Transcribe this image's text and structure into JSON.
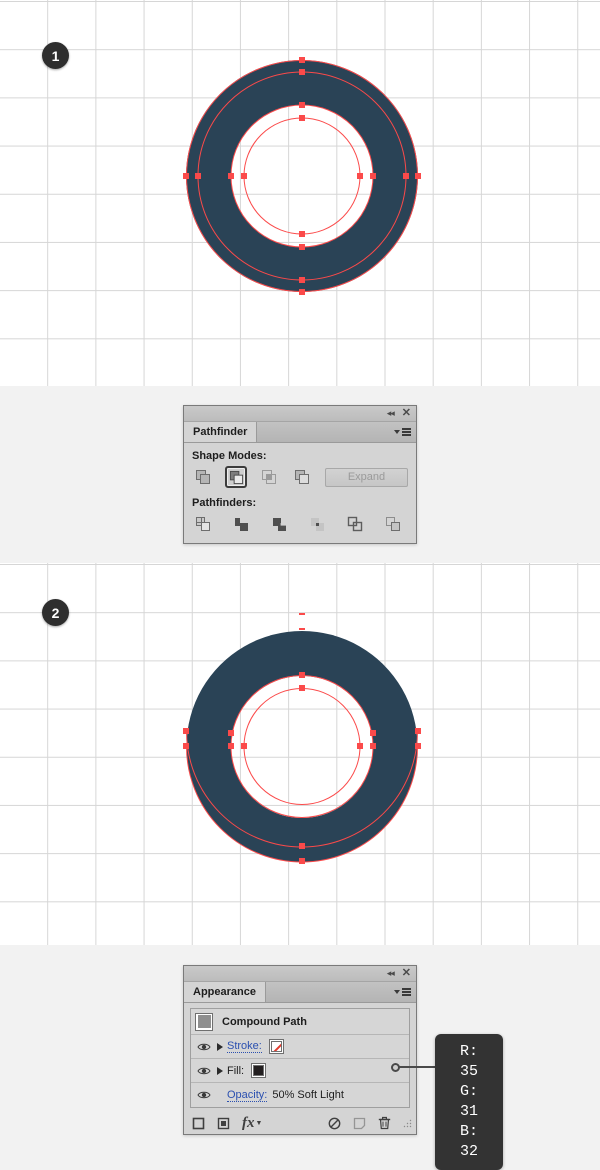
{
  "steps": [
    {
      "number": "1"
    },
    {
      "number": "2"
    }
  ],
  "artwork": {
    "fill_color": "#2a4356",
    "shade_color": "#1d3241",
    "path_color": "#fb4a4a",
    "anchor_color": "#fb4a4a",
    "step1_name": "donut-ring-flat",
    "step2_name": "donut-ring-extruded"
  },
  "pathfinder_panel": {
    "tab_label": "Pathfinder",
    "collapse_icon": "collapse-icon",
    "close_icon": "close-icon",
    "menu_icon": "panel-menu-icon",
    "shape_modes_label": "Shape Modes:",
    "pathfinders_label": "Pathfinders:",
    "expand_label": "Expand",
    "shape_modes": [
      {
        "name": "unite",
        "selected": false
      },
      {
        "name": "minus-front",
        "selected": true
      },
      {
        "name": "intersect",
        "selected": false
      },
      {
        "name": "exclude",
        "selected": false
      }
    ],
    "pathfinders": [
      {
        "name": "divide"
      },
      {
        "name": "trim"
      },
      {
        "name": "merge"
      },
      {
        "name": "crop"
      },
      {
        "name": "outline"
      },
      {
        "name": "minus-back"
      }
    ]
  },
  "appearance_panel": {
    "tab_label": "Appearance",
    "collapse_icon": "collapse-icon",
    "close_icon": "close-icon",
    "menu_icon": "panel-menu-icon",
    "object_label": "Compound Path",
    "rows": [
      {
        "label": "Stroke:",
        "value": "",
        "swatch": "none"
      },
      {
        "label": "Fill:",
        "value": "",
        "swatch": "solid-black"
      }
    ],
    "opacity_label": "Opacity:",
    "opacity_value": "50% Soft Light",
    "footer_icons": [
      "add-new-stroke-icon",
      "add-new-fill-icon",
      "add-new-effect-icon",
      "clear-appearance-icon",
      "duplicate-selected-item-icon",
      "delete-selected-item-icon"
    ]
  },
  "callout": {
    "r": "R: 35",
    "g": "G: 31",
    "b": "B: 32"
  }
}
